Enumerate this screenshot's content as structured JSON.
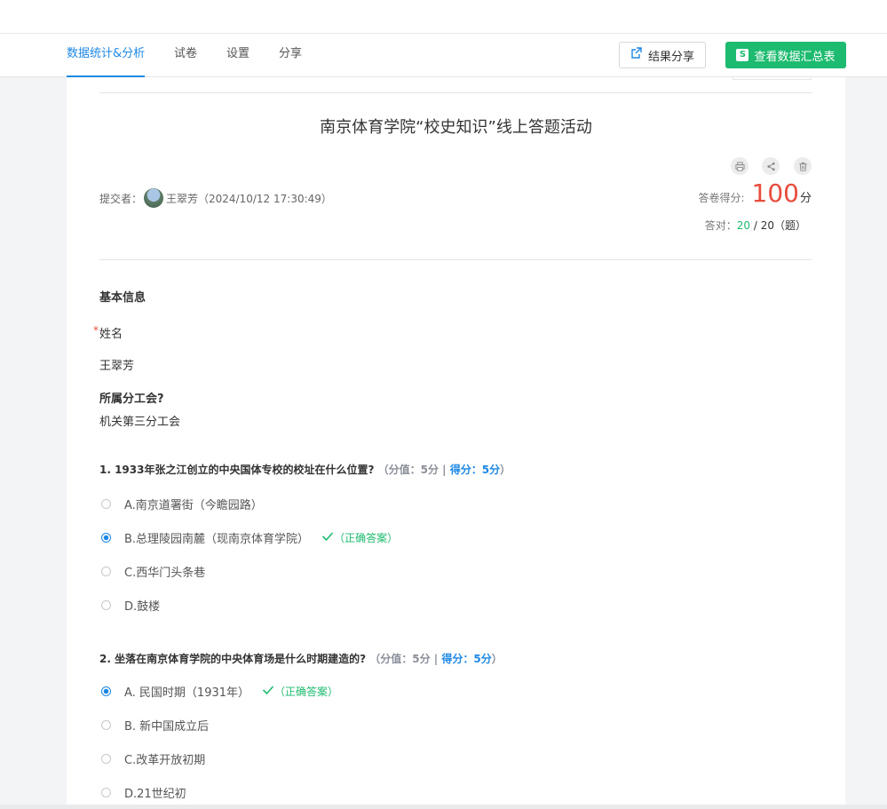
{
  "nav": {
    "tabs": [
      "数据统计&分析",
      "试卷",
      "设置",
      "分享"
    ],
    "share_button": "结果分享",
    "summary_button": "查看数据汇总表",
    "summary_badge": "S"
  },
  "survey": {
    "title": "南京体育学院“校史知识”线上答题活动",
    "submitter_label": "提交者：",
    "submitter_name": "王翠芳",
    "submit_time": "（2024/10/12 17:30:49）",
    "score_label": "答卷得分:",
    "score": "100",
    "score_unit": "分",
    "correct_label": "答对：",
    "correct_count": "20",
    "correct_total": "/ 20（题）"
  },
  "basic_info": {
    "section_title": "基本信息",
    "required_mark": "*",
    "name_label": "姓名",
    "name_value": "王翠芳",
    "union_label": "所属分工会?",
    "union_value": "机关第三分工会"
  },
  "questions": [
    {
      "title": "1. 1933年张之江创立的中央国体专校的校址在什么位置?",
      "meta": "（分值：5分 |",
      "score": "得分：5分",
      "meta_end": "）",
      "options": [
        "A.南京道署街（今瞻园路）",
        "B.总理陵园南麓（现南京体育学院）",
        "C.西华门头条巷",
        "D.鼓楼"
      ],
      "selected_index": 1,
      "correct_text": "（正确答案）"
    },
    {
      "title": "2. 坐落在南京体育学院的中央体育场是什么时期建造的?",
      "meta": "（分值：5分 |",
      "score": "得分：5分",
      "meta_end": "）",
      "options": [
        "A. 民国时期（1931年）",
        "B. 新中国成立后",
        "C.改革开放初期",
        "D.21世纪初"
      ],
      "selected_index": 0,
      "correct_text": "（正确答案）"
    }
  ],
  "icons": [
    "print-icon",
    "share-icon",
    "delete-icon",
    "export-icon",
    "check-icon"
  ],
  "colors": {
    "accent": "#1e88e5",
    "success": "#1dbb6f",
    "score": "#e74c3c"
  }
}
